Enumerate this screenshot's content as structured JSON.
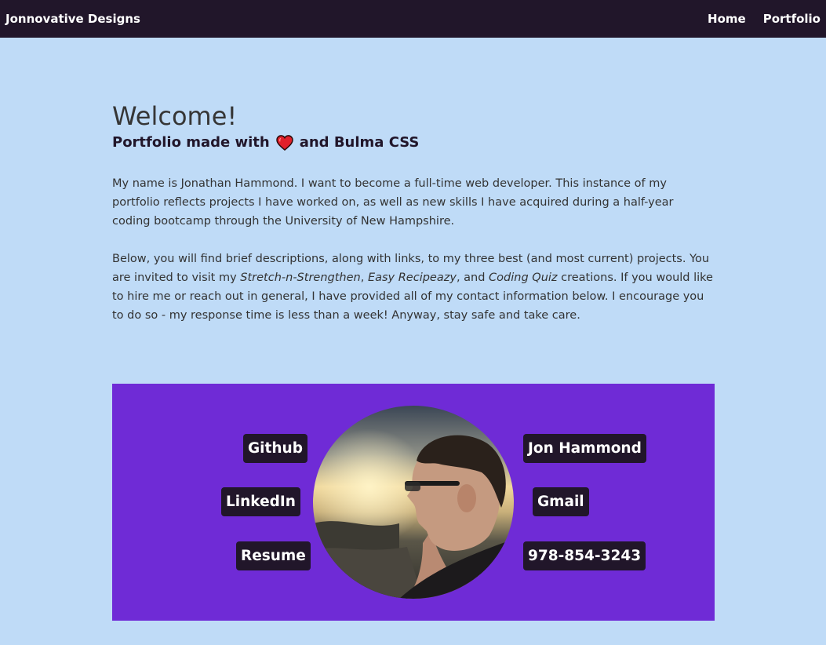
{
  "navbar": {
    "brand": "Jonnovative Designs",
    "links": [
      "Home",
      "Portfolio"
    ]
  },
  "hero": {
    "title": "Welcome!",
    "subtitle_before": "Portfolio made with",
    "subtitle_after": "and Bulma CSS",
    "heart_icon": "heart-icon",
    "heart_color": "#e0202a"
  },
  "intro": {
    "p1": "My name is Jonathan Hammond. I want to become a full-time web developer. This instance of my portfolio reflects projects I have worked on, as well as new skills I have acquired during a half-year coding bootcamp through the University of New Hampshire.",
    "p2_a": "Below, you will find brief descriptions, along with links, to my three best (and most current) projects. You are invited to visit my ",
    "p2_proj1": "Stretch-n-Strengthen",
    "p2_sep1": ", ",
    "p2_proj2": "Easy Recipeazy",
    "p2_sep2": ", and ",
    "p2_proj3": "Coding Quiz",
    "p2_b": " creations. If you would like to hire me or reach out in general, I have provided all of my contact information below. I encourage you to do so - my response time is less than a week! Anyway, stay safe and take care."
  },
  "contact": {
    "left": [
      "Github",
      "LinkedIn",
      "Resume"
    ],
    "right": [
      "Jon Hammond",
      "Gmail",
      "978-854-3243"
    ],
    "panel_color": "#6f2bd6",
    "tag_color": "#21162a"
  }
}
